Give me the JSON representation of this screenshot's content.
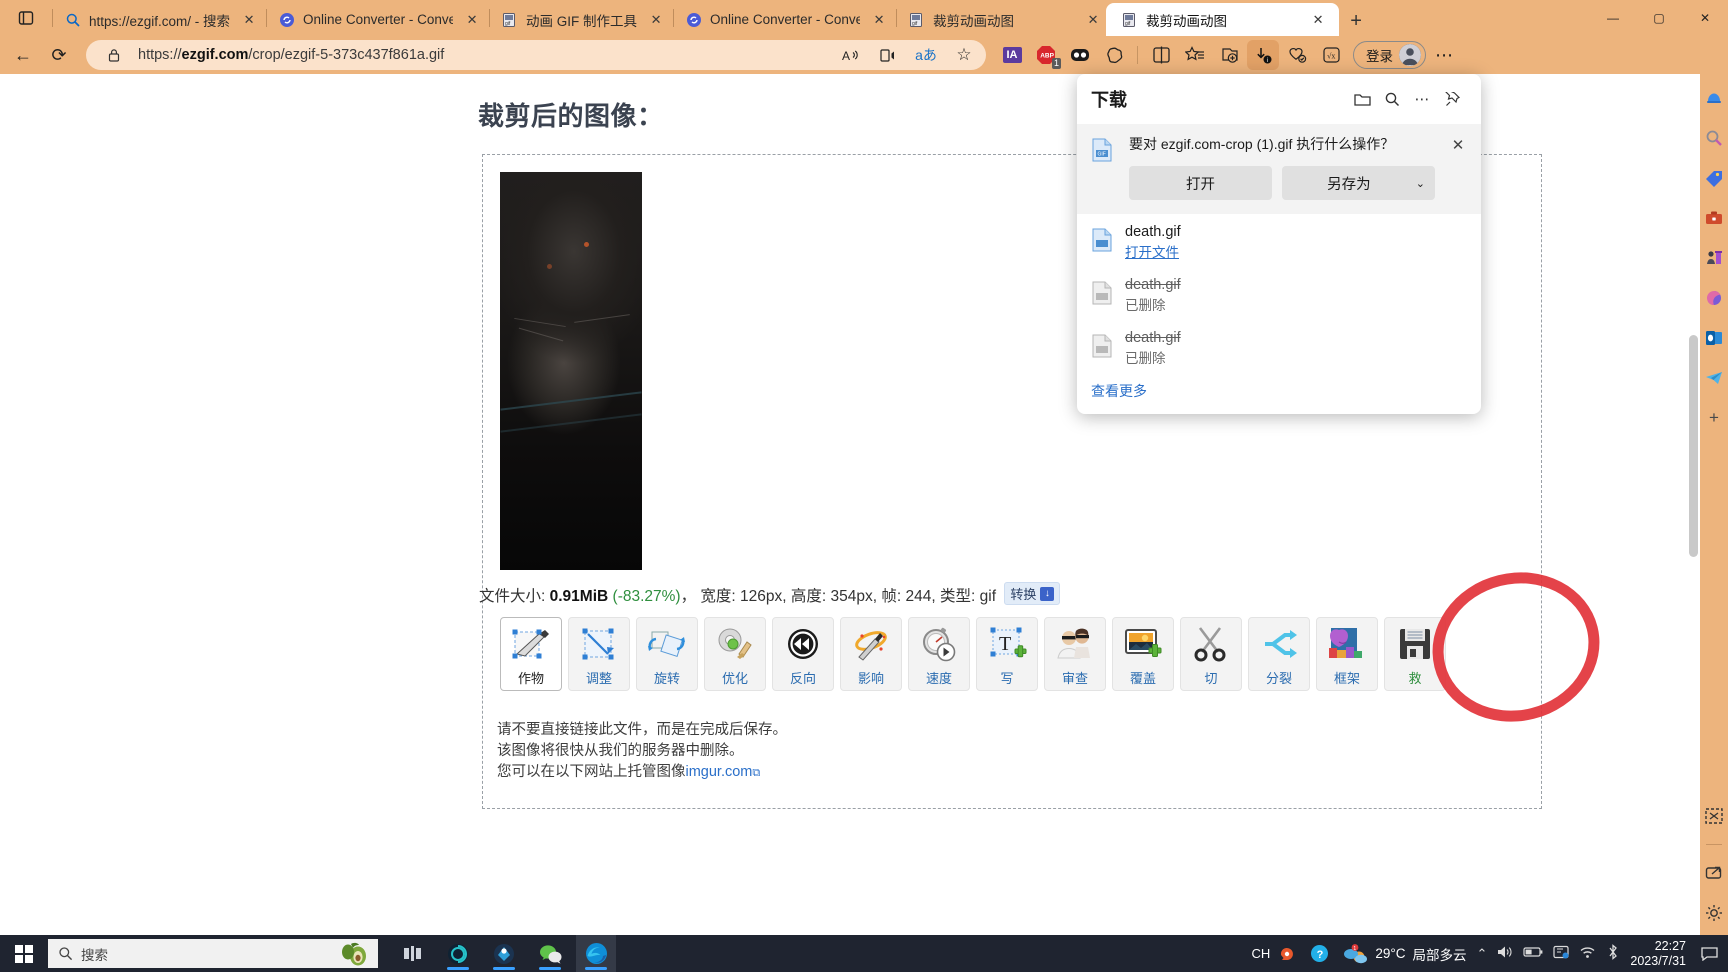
{
  "browser": {
    "tabs": [
      {
        "title": "https://ezgif.com/ - 搜索",
        "favicon": "search-icon",
        "active": false,
        "close": "✕"
      },
      {
        "title": "Online Converter - Convert",
        "favicon": "converter-icon",
        "active": false,
        "close": "✕"
      },
      {
        "title": "动画 GIF 制作工具",
        "favicon": "gif-icon",
        "active": false,
        "close": "✕"
      },
      {
        "title": "Online Converter - Convert",
        "favicon": "converter-icon",
        "active": false,
        "close": "✕"
      },
      {
        "title": "裁剪动画动图",
        "favicon": "gif-icon",
        "active": false,
        "close": "✕"
      },
      {
        "title": "裁剪动画动图",
        "favicon": "gif-icon",
        "active": true,
        "close": "✕"
      }
    ],
    "newtab_label": "+",
    "window_controls": {
      "minimize": "—",
      "maximize": "▢",
      "close": "✕"
    },
    "nav": {
      "back": "←",
      "reload": "⟳",
      "lock_icon": "lock-icon",
      "url_prefix": "https://",
      "url_domain": "ezgif.com",
      "url_path": "/crop/ezgif-5-373c437f861a.gif",
      "read_aloud": "A",
      "immersive_reader": "reader-icon",
      "translate": "aあ",
      "favorite": "☆"
    },
    "extensions": [
      {
        "name": "internet-archive-extension",
        "label": "IA"
      },
      {
        "name": "adblock-plus-extension",
        "label": "ABP",
        "badge": "1"
      },
      {
        "name": "unknown-dark-extension",
        "label": ""
      },
      {
        "name": "browser-essentials-extension",
        "label": ""
      }
    ],
    "toolbar_right": [
      {
        "name": "split-screen-button",
        "label": "⫿⫾"
      },
      {
        "name": "collections-button",
        "label": "☆≡"
      },
      {
        "name": "add-tab-group-button",
        "label": "⊞"
      },
      {
        "name": "downloads-button",
        "label": "↓",
        "active": true
      },
      {
        "name": "browser-essentials-button",
        "label": "♡"
      },
      {
        "name": "math-solver-button",
        "label": "√x"
      }
    ],
    "signin": {
      "label": "登录",
      "avatar": "avatar"
    },
    "settings_more": "⋯",
    "sidebar_icons": [
      "copilot-icon",
      "search-icon",
      "shopping-icon",
      "tools-icon",
      "games-icon",
      "office-icon",
      "outlook-icon",
      "telegram-icon",
      "add-icon"
    ],
    "sidebar_bottom_icons": [
      "screenshot-icon",
      "open-in-new-icon",
      "settings-icon"
    ]
  },
  "page": {
    "heading": "裁剪后的图像：",
    "image_alt": "cropped-gif-preview",
    "info": {
      "filesize_label": "文件大小:",
      "filesize_value": "0.91MiB",
      "filesize_pct": "(-83.27%)",
      "sep1": "，",
      "width_label": "宽度:",
      "width_value": "126px,",
      "height_label": "高度:",
      "height_value": "354px,",
      "frames_label": "帧:",
      "frames_value": "244,",
      "type_label": "类型:",
      "type_value": "gif",
      "convert_label": "转换",
      "convert_icon": "↓"
    },
    "tools": [
      {
        "name": "tool-crop",
        "label": "作物",
        "icon": "crop-icon",
        "selected": true
      },
      {
        "name": "tool-resize",
        "label": "调整",
        "icon": "resize-icon",
        "selected": false
      },
      {
        "name": "tool-rotate",
        "label": "旋转",
        "icon": "rotate-icon",
        "selected": false
      },
      {
        "name": "tool-optimize",
        "label": "优化",
        "icon": "optimize-icon",
        "selected": false
      },
      {
        "name": "tool-reverse",
        "label": "反向",
        "icon": "reverse-icon",
        "selected": false
      },
      {
        "name": "tool-effects",
        "label": "影响",
        "icon": "effects-icon",
        "selected": false
      },
      {
        "name": "tool-speed",
        "label": "速度",
        "icon": "speed-icon",
        "selected": false
      },
      {
        "name": "tool-write",
        "label": "写",
        "icon": "text-icon",
        "selected": false
      },
      {
        "name": "tool-censor",
        "label": "审查",
        "icon": "censor-icon",
        "selected": false
      },
      {
        "name": "tool-overlay",
        "label": "覆盖",
        "icon": "overlay-icon",
        "selected": false
      },
      {
        "name": "tool-cut",
        "label": "切",
        "icon": "scissors-icon",
        "selected": false
      },
      {
        "name": "tool-split",
        "label": "分裂",
        "icon": "split-icon",
        "selected": false
      },
      {
        "name": "tool-frames",
        "label": "框架",
        "icon": "frames-icon",
        "selected": false
      },
      {
        "name": "tool-save",
        "label": "救",
        "icon": "floppy-icon",
        "selected": false
      }
    ],
    "notes": {
      "line1": "请不要直接链接此文件，而是在完成后保存。",
      "line2": "该图像将很快从我们的服务器中删除。",
      "line3_prefix": "您可以在以下网站上托管图像",
      "line3_link": "imgur.com"
    }
  },
  "downloads_panel": {
    "title": "下载",
    "header_icons": [
      "folder-icon",
      "search-icon",
      "more-icon",
      "pin-icon"
    ],
    "prompt": "要对 ezgif.com-crop (1).gif 执行什么操作？",
    "close": "✕",
    "open_button": "打开",
    "saveas_button": "另存为",
    "saveas_chevron": "⌄",
    "items": [
      {
        "name": "death.gif",
        "status": "打开文件",
        "deleted": false
      },
      {
        "name": "death.gif",
        "status": "已删除",
        "deleted": true
      },
      {
        "name": "death.gif",
        "status": "已删除",
        "deleted": true
      }
    ],
    "see_more": "查看更多"
  },
  "taskbar": {
    "start": "start-icon",
    "search_placeholder": "搜索",
    "search_icon": "search-icon",
    "apps": [
      {
        "name": "taskview-icon",
        "glyph": "⊟"
      },
      {
        "name": "app-unknown-icon",
        "glyph": "◎"
      },
      {
        "name": "steam-icon",
        "glyph": "✈"
      },
      {
        "name": "wechat-icon",
        "glyph": "💬"
      },
      {
        "name": "edge-icon",
        "glyph": "◉"
      }
    ],
    "ime": {
      "lang": "CH",
      "icon": "sogou-icon"
    },
    "help_icon": "help-icon",
    "weather": {
      "temp": "29°C",
      "desc": "局部多云"
    },
    "tray_icons": [
      "chevron-up-icon",
      "volume-icon",
      "battery-icon",
      "display-icon",
      "wifi-icon",
      "bluetooth-icon"
    ],
    "clock": {
      "time": "22:27",
      "date": "2023/7/31"
    },
    "notifications": "notification-icon"
  }
}
